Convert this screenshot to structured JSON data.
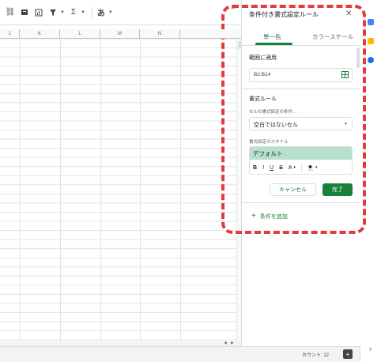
{
  "toolbar": {
    "icons": [
      "link-icon",
      "comment-icon",
      "chart-icon",
      "filter-icon",
      "sigma-icon",
      "input-tools-icon"
    ],
    "sigma_label": "Σ",
    "input_label": "あ",
    "collapse_icon": "chevron-up-icon"
  },
  "sheet": {
    "columns": [
      "J",
      "K",
      "L",
      "M",
      "N",
      ""
    ],
    "row_count": 34
  },
  "bottom_bar": {
    "count_label": "カウント: 12"
  },
  "panel": {
    "title": "条件付き書式設定ルール",
    "tabs": [
      "単一色",
      "カラースケール"
    ],
    "active_tab": "単一色",
    "apply_range_label": "範囲に適用",
    "range_value": "B2:B14",
    "format_rules_label": "書式ルール",
    "condition_label": "セルの書式設定の条件…",
    "condition_value": "空白ではないセル",
    "style_label": "書式設定のスタイル",
    "style_preview": "デフォルト",
    "format_buttons": [
      "B",
      "I",
      "U",
      "S",
      "A"
    ],
    "cancel_label": "キャンセル",
    "done_label": "完了",
    "add_condition_label": "条件を追加"
  },
  "colors": {
    "accent": "#188038",
    "style_fill": "#b7e1cd",
    "annotation": "#e03d3d"
  }
}
